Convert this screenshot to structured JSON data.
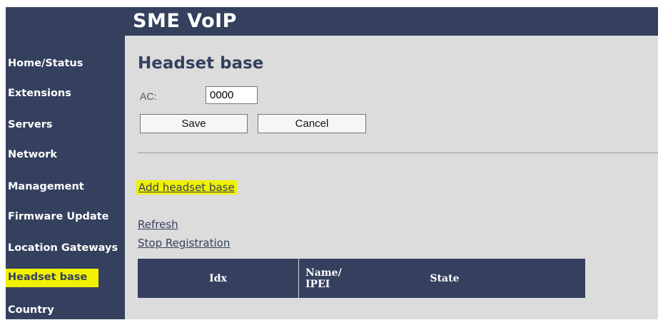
{
  "header": {
    "title": "SME VoIP"
  },
  "sidebar": {
    "items": [
      {
        "label": "Home/Status"
      },
      {
        "label": "Extensions"
      },
      {
        "label": "Servers"
      },
      {
        "label": "Network"
      },
      {
        "label": "Management"
      },
      {
        "label": "Firmware Update"
      },
      {
        "label": "Location Gateways"
      },
      {
        "label": "Headset base",
        "active": true
      },
      {
        "label": "Country"
      }
    ]
  },
  "main": {
    "title": "Headset base",
    "ac_label": "AC:",
    "ac_value": "0000",
    "save_label": "Save",
    "cancel_label": "Cancel",
    "add_link": "Add headset base",
    "refresh_link": "Refresh",
    "stop_link": "Stop Registration",
    "table": {
      "columns": [
        "Idx",
        "Name/\nIPEI",
        "State"
      ],
      "col_idx": "Idx",
      "col_name_line1": "Name/",
      "col_name_line2": "IPEI",
      "col_state": "State"
    }
  },
  "colors": {
    "navy": "#34405e",
    "highlight": "#f0f000",
    "content_bg": "#dcdcdc"
  }
}
